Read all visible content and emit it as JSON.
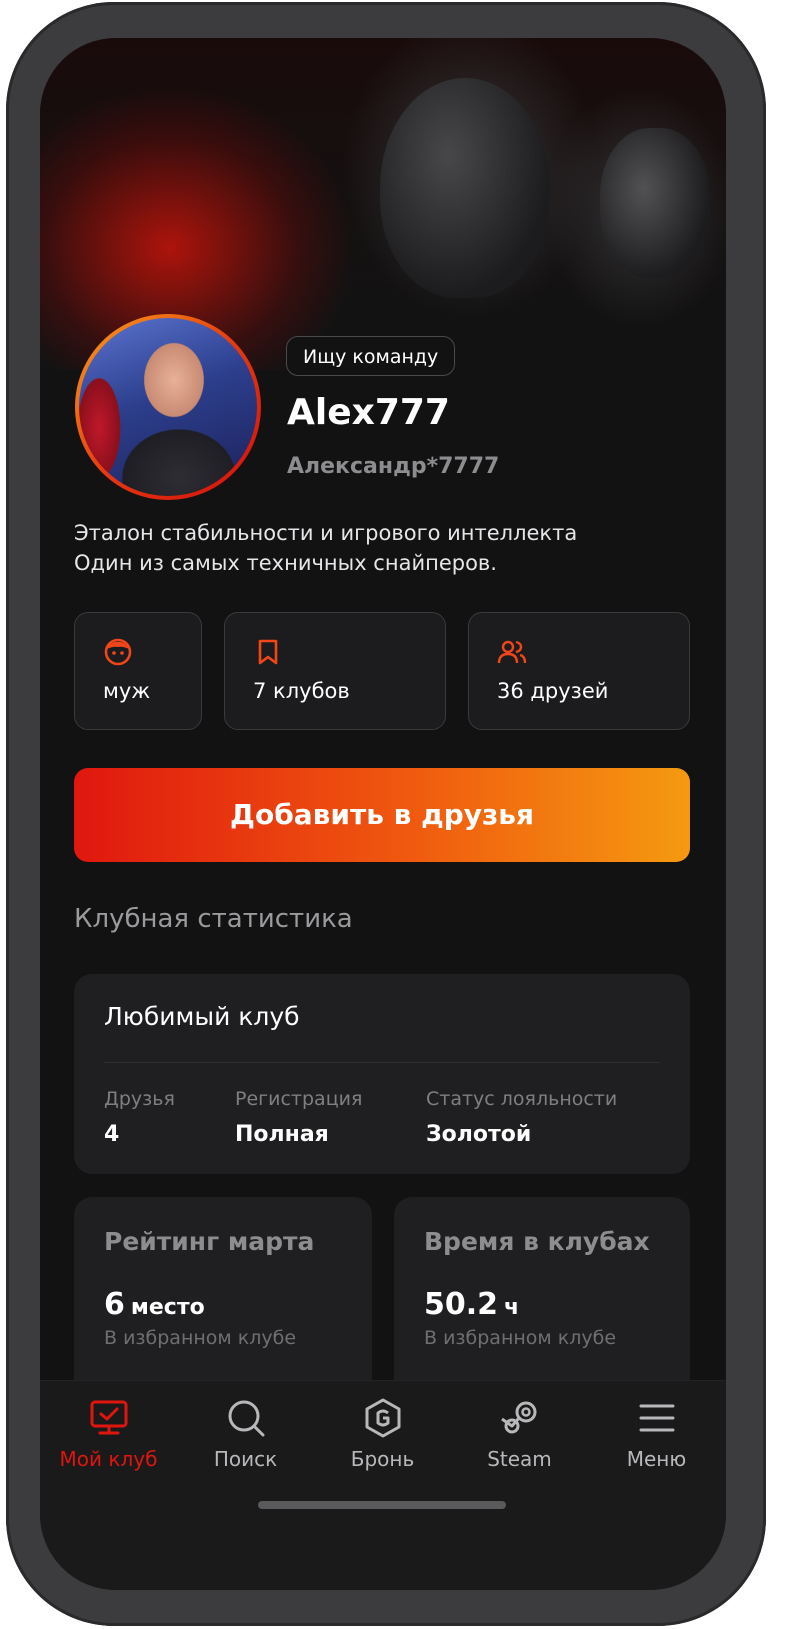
{
  "profile": {
    "status_tag": "Ищу команду",
    "nickname": "Alex777",
    "real_name": "Александр*7777",
    "bio_line1": "Эталон стабильности и игрового интеллекта",
    "bio_line2": "Один из самых техничных снайперов."
  },
  "stats": [
    {
      "label": "муж",
      "icon": "face-icon"
    },
    {
      "label": "7 клубов",
      "icon": "bookmark-icon"
    },
    {
      "label": "36 друзей",
      "icon": "users-icon"
    }
  ],
  "add_friend_button": "Добавить в друзья",
  "club_stats": {
    "section_title": "Клубная статистика",
    "favorite": {
      "title": "Любимый клуб",
      "friends_label": "Друзья",
      "friends_value": "4",
      "registration_label": "Регистрация",
      "registration_value": "Полная",
      "loyalty_label": "Статус лояльности",
      "loyalty_value": "Золотой"
    },
    "rating": {
      "title": "Рейтинг марта",
      "value": "6",
      "unit": "место",
      "subtitle": "В избранном клубе"
    },
    "time": {
      "title": "Время в клубах",
      "value": "50.2",
      "unit": "ч",
      "subtitle": "В избранном клубе"
    }
  },
  "tabbar": {
    "items": [
      {
        "label": "Мой клуб",
        "icon": "monitor-icon",
        "active": true
      },
      {
        "label": "Поиск",
        "icon": "search-icon",
        "active": false
      },
      {
        "label": "Бронь",
        "icon": "logo-icon",
        "active": false
      },
      {
        "label": "Steam",
        "icon": "steam-icon",
        "active": false
      },
      {
        "label": "Меню",
        "icon": "menu-icon",
        "active": false
      }
    ]
  },
  "colors": {
    "accent": "#E0150E",
    "accent_gradient_end": "#F59A10",
    "background": "#121213",
    "card": "#1F1F21"
  }
}
